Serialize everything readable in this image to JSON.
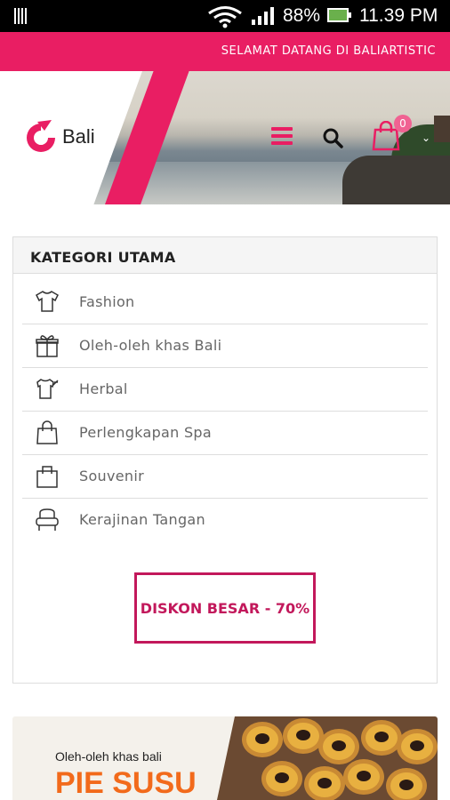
{
  "statusbar": {
    "battery_pct": "88%",
    "time": "11.39 PM"
  },
  "header": {
    "welcome_text": "SELAMAT DATANG DI BALIARTISTIC",
    "logo_text": "Bali",
    "cart_count": "0"
  },
  "categories": {
    "title": "KATEGORI UTAMA",
    "items": [
      {
        "label": "Fashion",
        "icon": "tshirt-icon"
      },
      {
        "label": "Oleh-oleh khas Bali",
        "icon": "gift-icon"
      },
      {
        "label": "Herbal",
        "icon": "herbal-icon"
      },
      {
        "label": "Perlengkapan Spa",
        "icon": "bag-icon"
      },
      {
        "label": "Souvenir",
        "icon": "shopping-bag-icon"
      },
      {
        "label": "Kerajinan Tangan",
        "icon": "chair-icon"
      }
    ]
  },
  "promo": {
    "discount_label": "DISKON BESAR - 70%"
  },
  "banner": {
    "subtitle": "Oleh-oleh  khas bali",
    "title": "PIE SUSU"
  },
  "colors": {
    "accent": "#e91e63",
    "discount": "#c2185b",
    "banner_title": "#f26a1b"
  }
}
